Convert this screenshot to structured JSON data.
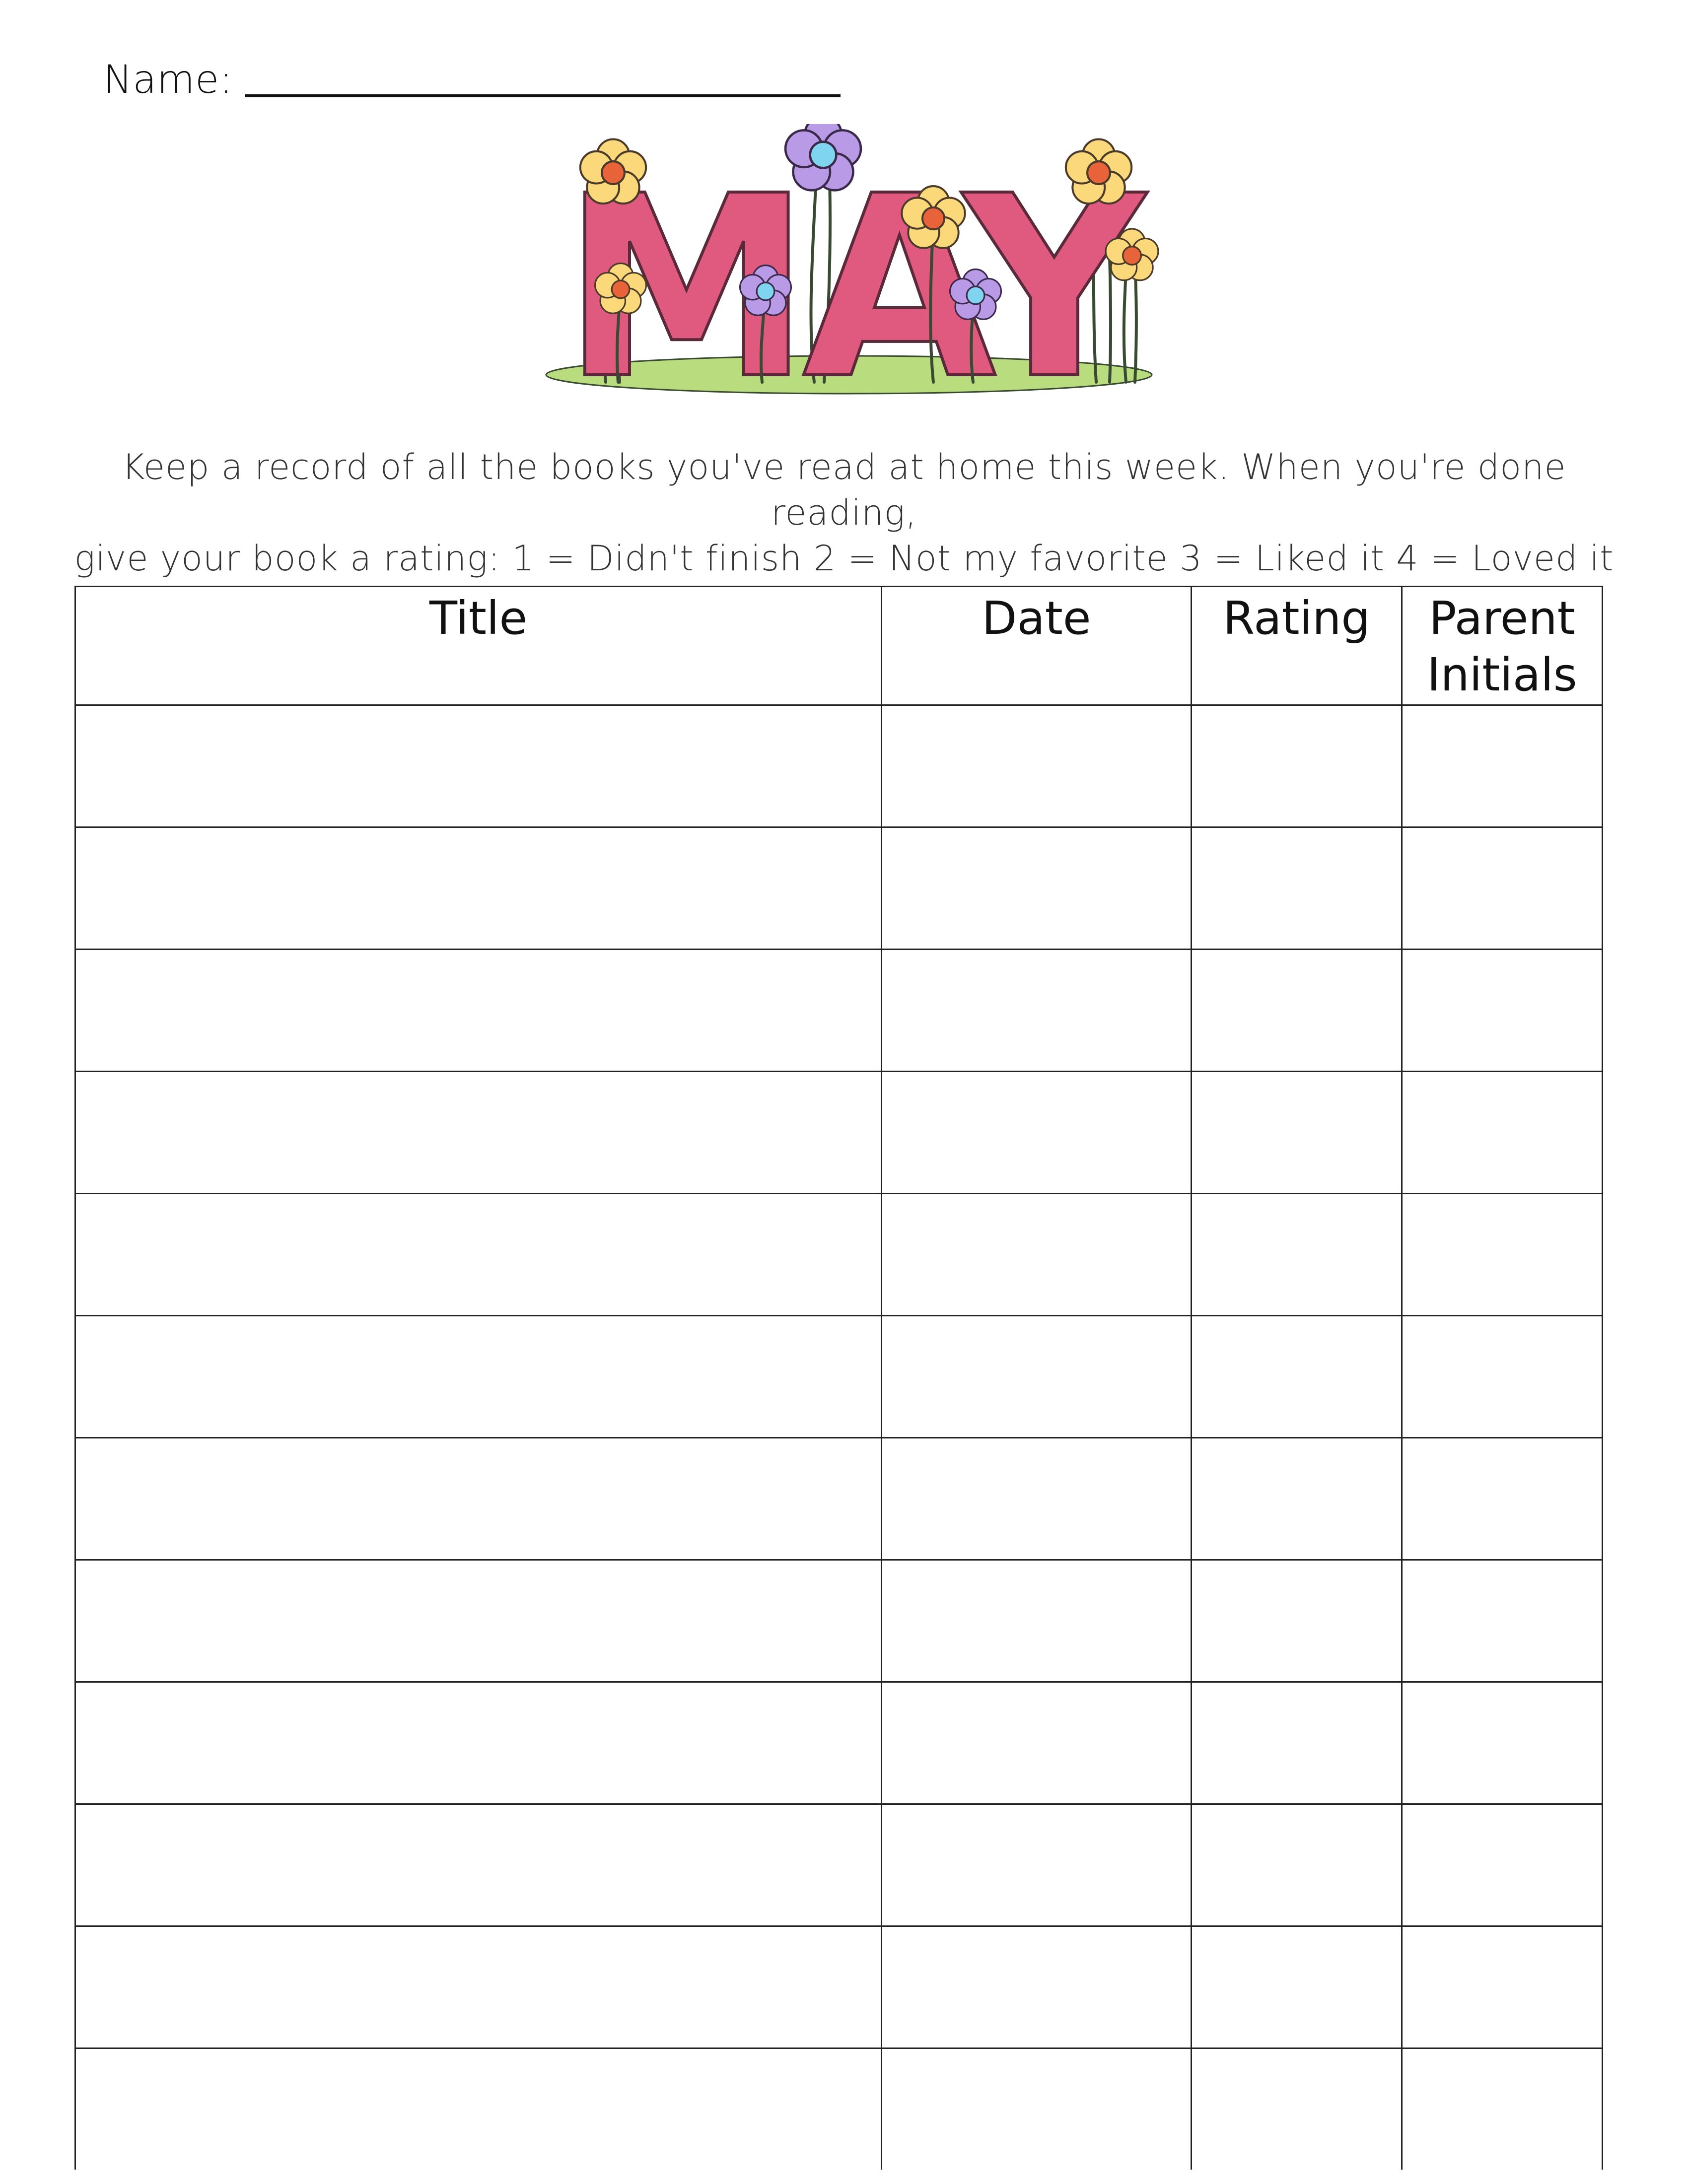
{
  "header": {
    "name_label": "Name:"
  },
  "banner": {
    "word": "MAY",
    "colors": {
      "letter_fill": "#e05a80",
      "letter_stroke": "#b83a60",
      "grass": "#b9dc7e",
      "yellow_petal": "#fbd97a",
      "purple_petal": "#b99ae6",
      "orange_center": "#e8623a",
      "blue_center": "#7fd4f0",
      "stem": "#3a4a32"
    },
    "icons": [
      "yellow-flower-icon",
      "purple-flower-icon",
      "grass-mound-icon"
    ]
  },
  "instructions": {
    "line1": "Keep a record of all the books you've read at home this week. When you're done reading,",
    "line2": "give your book a rating: 1 = Didn't finish  2 = Not my favorite  3 = Liked it  4 = Loved it"
  },
  "table": {
    "headers": {
      "title": "Title",
      "date": "Date",
      "rating": "Rating",
      "parent_line1": "Parent",
      "parent_line2": "Initials"
    },
    "rows": [
      {
        "title": "",
        "date": "",
        "rating": "",
        "parent": ""
      },
      {
        "title": "",
        "date": "",
        "rating": "",
        "parent": ""
      },
      {
        "title": "",
        "date": "",
        "rating": "",
        "parent": ""
      },
      {
        "title": "",
        "date": "",
        "rating": "",
        "parent": ""
      },
      {
        "title": "",
        "date": "",
        "rating": "",
        "parent": ""
      },
      {
        "title": "",
        "date": "",
        "rating": "",
        "parent": ""
      },
      {
        "title": "",
        "date": "",
        "rating": "",
        "parent": ""
      },
      {
        "title": "",
        "date": "",
        "rating": "",
        "parent": ""
      },
      {
        "title": "",
        "date": "",
        "rating": "",
        "parent": ""
      },
      {
        "title": "",
        "date": "",
        "rating": "",
        "parent": ""
      },
      {
        "title": "",
        "date": "",
        "rating": "",
        "parent": ""
      },
      {
        "title": "",
        "date": "",
        "rating": "",
        "parent": ""
      }
    ]
  }
}
